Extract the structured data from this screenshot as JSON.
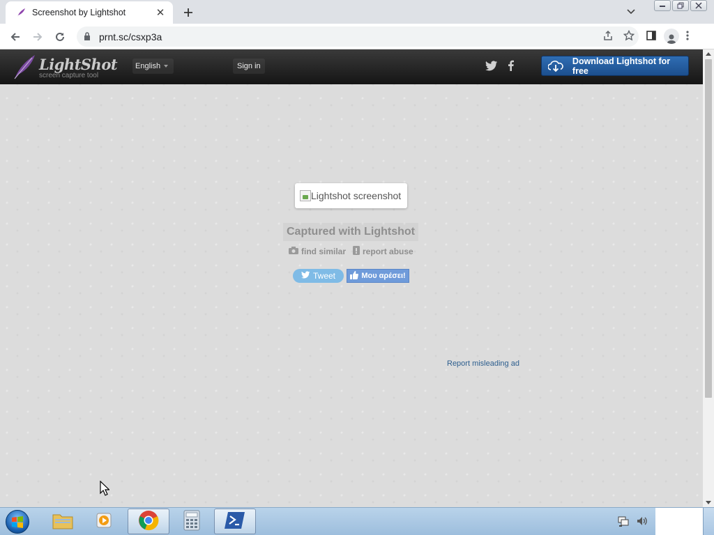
{
  "browser": {
    "tab": {
      "title": "Screenshot by Lightshot"
    },
    "address": {
      "url": "prnt.sc/csxp3a"
    }
  },
  "site": {
    "logo": {
      "name": "LightShot",
      "tagline": "screen capture tool"
    },
    "language": "English",
    "signin": "Sign in",
    "download": "Download Lightshot for free"
  },
  "content": {
    "screenshot_alt": "Lightshot screenshot",
    "captured": "Captured with Lightshot",
    "find_similar": "find similar",
    "report_abuse": "report abuse",
    "tweet": "Tweet",
    "like": "Μου αρέσει!",
    "report_ad": "Report misleading ad"
  },
  "colors": {
    "header_bg": "#1e1e1e",
    "download_btn": "#2461a6",
    "tweet_btn": "#7fbbe6",
    "like_btn": "#6f9bda",
    "page_bg": "#dcdcdc",
    "link": "#2d5e8e"
  },
  "taskbar": {
    "items": [
      "start-orb",
      "file-explorer",
      "media-player",
      "chrome",
      "calculator",
      "powershell"
    ]
  }
}
